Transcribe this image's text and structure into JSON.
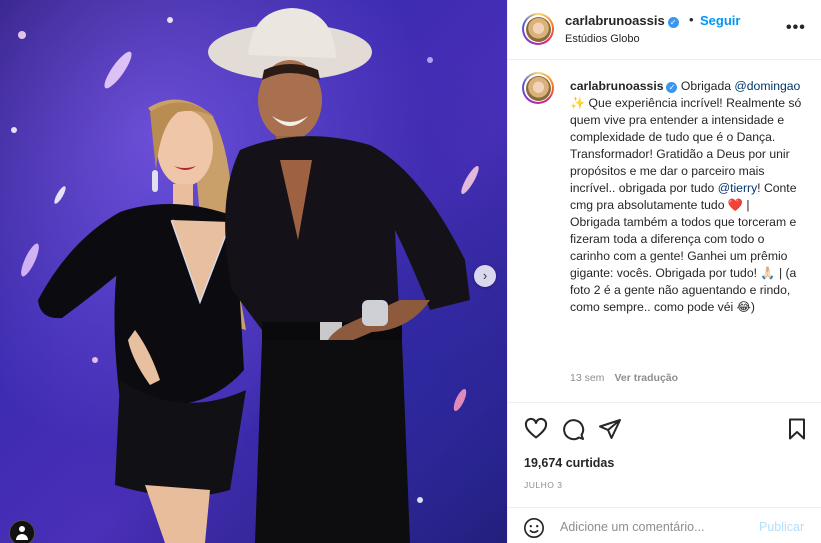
{
  "post": {
    "username": "carlabrunoassis",
    "verified_icon": "verified-badge-icon",
    "separator": "•",
    "follow_label": "Seguir",
    "location": "Estúdios Globo",
    "more_icon": "more-options-icon",
    "more_glyph": "•••"
  },
  "caption": {
    "username": "carlabrunoassis",
    "text_1": " Obrigada ",
    "mention_1": "@domingao",
    "text_2": " ✨ Que experiência incrível! Realmente só quem vive pra entender a intensidade e complexidade de tudo que é o Dança. Transformador! Gratidão a Deus por unir propósitos e me dar o parceiro mais incrível.. obrigada por tudo ",
    "mention_2": "@tierry",
    "text_3": "! Conte cmg pra absolutamente tudo ❤️ | Obrigada também a todos que torceram e fizeram toda a diferença com todo o carinho com a gente! Ganhei um prêmio gigante: vocês. Obrigada por tudo! 🙏🏻 | (a foto 2 é a gente não aguentando e rindo, como sempre.. como pode véi 😂)",
    "age": "13 sem",
    "translate_label": "Ver tradução"
  },
  "actions": {
    "like_icon": "heart-icon",
    "comment_icon": "comment-icon",
    "share_icon": "share-icon",
    "save_icon": "bookmark-icon"
  },
  "likes_text": "19,674 curtidas",
  "date_text": "JULHO 3",
  "comment": {
    "emoji_icon": "emoji-icon",
    "placeholder": "Adicione um comentário...",
    "post_label": "Publicar"
  },
  "carousel": {
    "next_glyph": "›",
    "current_index": 1,
    "total": 2
  },
  "colors": {
    "accent": "#0095f6",
    "verified": "#3897f0",
    "mention": "#00376b",
    "muted": "#8e8e8e",
    "post_disabled": "#b2dffc"
  }
}
